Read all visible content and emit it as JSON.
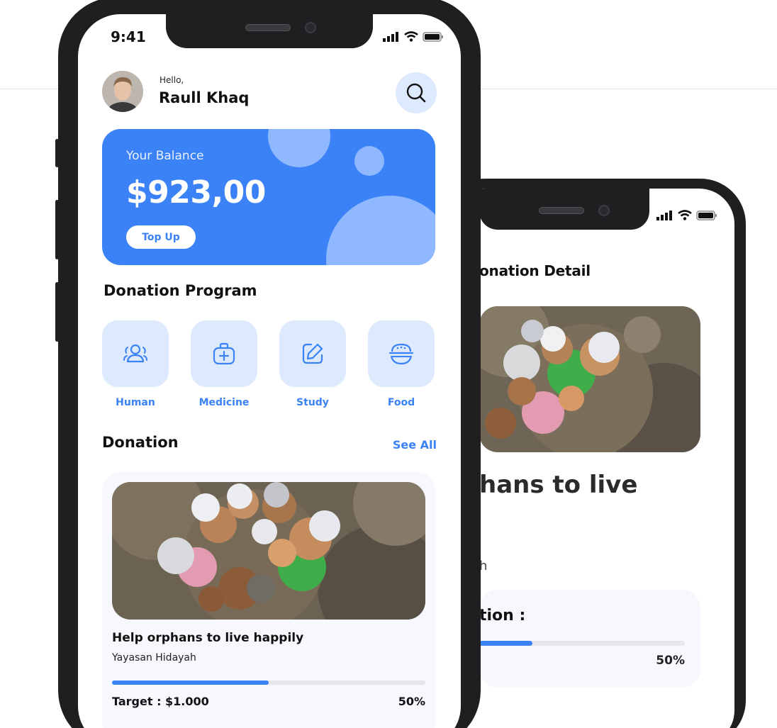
{
  "front": {
    "status": {
      "time": "9:41"
    },
    "header": {
      "greeting": "Hello,",
      "user_name": "Raull Khaq"
    },
    "balance": {
      "label": "Your Balance",
      "amount": "$923,00",
      "topup_label": "Top Up"
    },
    "program": {
      "title": "Donation Program",
      "categories": [
        {
          "label": "Human",
          "icon": "people-icon"
        },
        {
          "label": "Medicine",
          "icon": "medical-kit-icon"
        },
        {
          "label": "Study",
          "icon": "edit-icon"
        },
        {
          "label": "Food",
          "icon": "food-bowl-icon"
        }
      ]
    },
    "donation": {
      "title": "Donation",
      "see_all": "See All",
      "card": {
        "name": "Help orphans to live happily",
        "org": "Yayasan Hidayah",
        "target": "Target : $1.000",
        "percent_label": "50%",
        "progress": 0.5
      }
    }
  },
  "back": {
    "title": "onation Detail",
    "big_title": "hans to live",
    "org_partial": "h",
    "info_label": "tion :",
    "percent_label": "50%",
    "progress_visible_fraction": 0.26
  },
  "colors": {
    "accent": "#3b82f6",
    "tile": "#dde9fd",
    "card": "#f6f8fd"
  }
}
